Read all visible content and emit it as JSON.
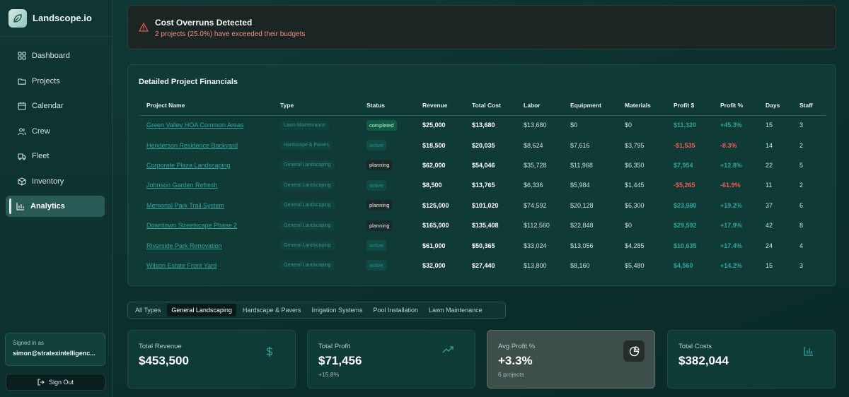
{
  "brand": {
    "name": "Landscope.io"
  },
  "nav": [
    {
      "label": "Dashboard",
      "icon": "grid-icon"
    },
    {
      "label": "Projects",
      "icon": "folder-icon"
    },
    {
      "label": "Calendar",
      "icon": "calendar-icon"
    },
    {
      "label": "Crew",
      "icon": "users-icon"
    },
    {
      "label": "Fleet",
      "icon": "truck-icon"
    },
    {
      "label": "Inventory",
      "icon": "box-icon"
    },
    {
      "label": "Analytics",
      "icon": "bar-chart-icon",
      "active": true
    }
  ],
  "user": {
    "signed_in_label": "Signed in as",
    "email": "simon@stratexintelligenc..."
  },
  "signout": {
    "label": "Sign Out"
  },
  "alert": {
    "title": "Cost Overruns Detected",
    "description": "2 projects (25.0%) have exceeded their budgets"
  },
  "financials": {
    "title": "Detailed Project Financials",
    "columns": [
      "Project Name",
      "Type",
      "Status",
      "Revenue",
      "Total Cost",
      "Labor",
      "Equipment",
      "Materials",
      "Profit $",
      "Profit %",
      "Days",
      "Staff"
    ],
    "rows": [
      {
        "name": "Green Valley HOA Common Areas",
        "type": "Lawn Maintenance",
        "status": "completed",
        "revenue": "$25,000",
        "total_cost": "$13,680",
        "labor": "$13,680",
        "equipment": "$0",
        "materials": "$0",
        "profit": "$11,320",
        "profit_pct": "+45.3%",
        "days": "15",
        "staff": "3",
        "negative": false
      },
      {
        "name": "Henderson Residence Backyard",
        "type": "Hardscape & Pavers",
        "status": "active",
        "revenue": "$18,500",
        "total_cost": "$20,035",
        "labor": "$8,624",
        "equipment": "$7,616",
        "materials": "$3,795",
        "profit": "-$1,535",
        "profit_pct": "-8.3%",
        "days": "14",
        "staff": "2",
        "negative": true
      },
      {
        "name": "Corporate Plaza Landscaping",
        "type": "General Landscaping",
        "status": "planning",
        "revenue": "$62,000",
        "total_cost": "$54,046",
        "labor": "$35,728",
        "equipment": "$11,968",
        "materials": "$6,350",
        "profit": "$7,954",
        "profit_pct": "+12.8%",
        "days": "22",
        "staff": "5",
        "negative": false
      },
      {
        "name": "Johnson Garden Refresh",
        "type": "General Landscaping",
        "status": "active",
        "revenue": "$8,500",
        "total_cost": "$13,765",
        "labor": "$6,336",
        "equipment": "$5,984",
        "materials": "$1,445",
        "profit": "-$5,265",
        "profit_pct": "-61.9%",
        "days": "11",
        "staff": "2",
        "negative": true
      },
      {
        "name": "Memorial Park Trail System",
        "type": "General Landscaping",
        "status": "planning",
        "revenue": "$125,000",
        "total_cost": "$101,020",
        "labor": "$74,592",
        "equipment": "$20,128",
        "materials": "$6,300",
        "profit": "$23,980",
        "profit_pct": "+19.2%",
        "days": "37",
        "staff": "6",
        "negative": false
      },
      {
        "name": "Downtown Streetscape Phase 2",
        "type": "General Landscaping",
        "status": "planning",
        "revenue": "$165,000",
        "total_cost": "$135,408",
        "labor": "$112,560",
        "equipment": "$22,848",
        "materials": "$0",
        "profit": "$29,592",
        "profit_pct": "+17.9%",
        "days": "42",
        "staff": "8",
        "negative": false
      },
      {
        "name": "Riverside Park Renovation",
        "type": "General Landscaping",
        "status": "active",
        "revenue": "$61,000",
        "total_cost": "$50,365",
        "labor": "$33,024",
        "equipment": "$13,056",
        "materials": "$4,285",
        "profit": "$10,635",
        "profit_pct": "+17.4%",
        "days": "24",
        "staff": "4",
        "negative": false
      },
      {
        "name": "Wilson Estate Front Yard",
        "type": "General Landscaping",
        "status": "active",
        "revenue": "$32,000",
        "total_cost": "$27,440",
        "labor": "$13,800",
        "equipment": "$8,160",
        "materials": "$5,480",
        "profit": "$4,560",
        "profit_pct": "+14.2%",
        "days": "15",
        "staff": "3",
        "negative": false
      }
    ]
  },
  "filter_tabs": [
    {
      "label": "All Types"
    },
    {
      "label": "General Landscaping",
      "active": true
    },
    {
      "label": "Hardscape & Pavers"
    },
    {
      "label": "Irrigation Systems"
    },
    {
      "label": "Pool Installation"
    },
    {
      "label": "Lawn Maintenance"
    }
  ],
  "stats": [
    {
      "label": "Total Revenue",
      "value": "$453,500",
      "sub": "",
      "icon": "dollar-icon"
    },
    {
      "label": "Total Profit",
      "value": "$71,456",
      "sub": "+15.8%",
      "icon": "trending-up-icon"
    },
    {
      "label": "Avg Profit %",
      "value": "+3.3%",
      "sub": "6 projects",
      "icon": "pie-chart-icon",
      "highlighted": true
    },
    {
      "label": "Total Costs",
      "value": "$382,044",
      "sub": "",
      "icon": "bar-chart-icon"
    }
  ],
  "colors": {
    "accent": "#2ea59a",
    "negative": "#ef5a55",
    "alert_text": "#f08a84"
  }
}
